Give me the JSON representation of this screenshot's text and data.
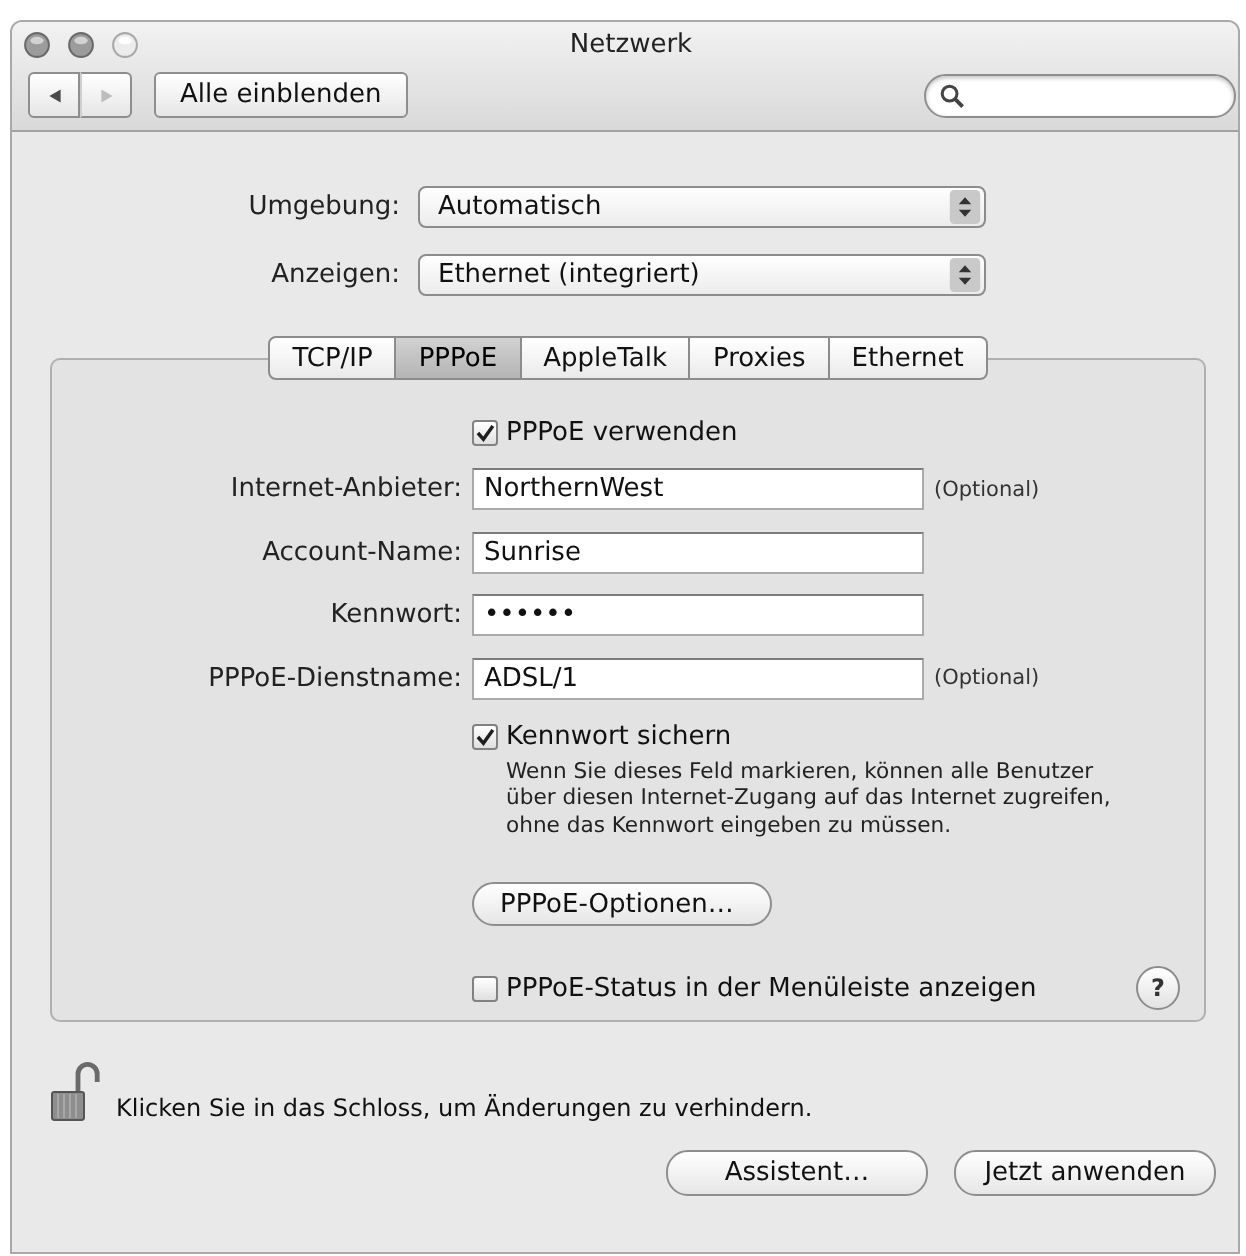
{
  "window": {
    "title": "Netzwerk",
    "controls": [
      {
        "disabled": false
      },
      {
        "disabled": false
      },
      {
        "disabled": true
      }
    ]
  },
  "toolbar": {
    "nav": [
      {
        "kind": "back",
        "disabled": false
      },
      {
        "kind": "forward",
        "disabled": true
      }
    ],
    "show_all_button": "Alle einblenden"
  },
  "popups": [
    {
      "label": "Umgebung:",
      "value": "Automatisch"
    },
    {
      "label": "Anzeigen:",
      "value": "Ethernet (integriert)"
    }
  ],
  "tabs": [
    {
      "label": "TCP/IP",
      "selected": false
    },
    {
      "label": "PPPoE",
      "selected": true
    },
    {
      "label": "AppleTalk",
      "selected": false
    },
    {
      "label": "Proxies",
      "selected": false
    },
    {
      "label": "Ethernet",
      "selected": false
    }
  ],
  "pppoe": {
    "use_checkbox": {
      "label": "PPPoE verwenden",
      "checked": true
    },
    "fields": [
      {
        "label": "Internet-Anbieter:",
        "value": "NorthernWest",
        "note": "(Optional)"
      },
      {
        "label": "Account-Name:",
        "value": "Sunrise"
      },
      {
        "label": "Kennwort:",
        "value": "••••••"
      },
      {
        "label": "PPPoE-Dienstname:",
        "value": "ADSL/1",
        "note": "(Optional)"
      }
    ],
    "save_password": {
      "label": "Kennwort sichern",
      "checked": true,
      "description": "Wenn Sie dieses Feld markieren, können alle Benutzer über diesen Internet-Zugang auf das Internet zugreifen, ohne das Kennwort eingeben zu müssen."
    },
    "options_button": "PPPoE-Optionen…",
    "status_checkbox": {
      "label": "PPPoE-Status in der Menüleiste anzeigen",
      "checked": false
    },
    "help_button": "?"
  },
  "footer": {
    "lock": {
      "locked": false,
      "text": "Klicken Sie in das Schloss, um Änderungen zu verhindern."
    },
    "buttons": [
      "Assistent…",
      "Jetzt anwenden"
    ]
  }
}
